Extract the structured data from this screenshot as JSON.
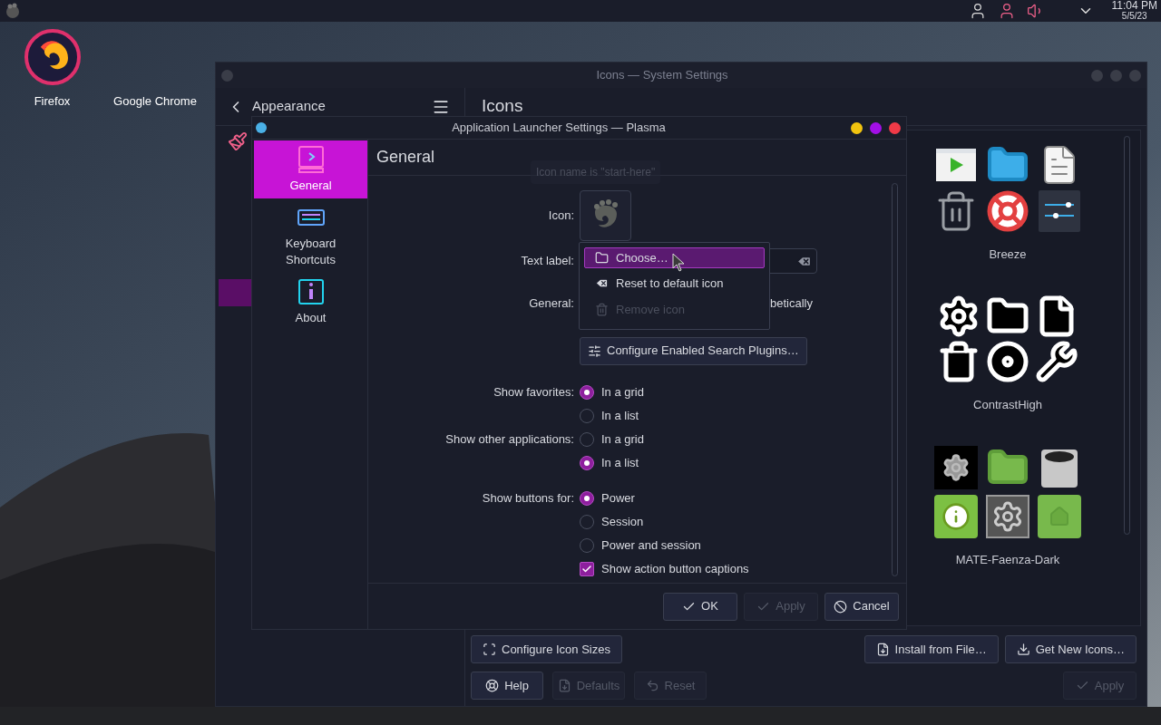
{
  "panel": {
    "time": "11:04 PM",
    "date": "5/5/23"
  },
  "desktop_icons": [
    {
      "label": "Firefox"
    },
    {
      "label": "Google Chrome"
    }
  ],
  "settings_window": {
    "title": "Icons — System Settings",
    "back_label": "Appearance",
    "page_title": "Icons",
    "themes": [
      {
        "name": "Breeze"
      },
      {
        "name": "ContrastHigh"
      },
      {
        "name": "MATE-Faenza-Dark"
      }
    ],
    "row_left": [
      {
        "label": "Configure Icon Sizes",
        "disabled": false
      }
    ],
    "row_right": [
      {
        "label": "Install from File…",
        "disabled": false
      },
      {
        "label": "Get New Icons…",
        "disabled": false
      }
    ],
    "footer_left": [
      {
        "label": "Help",
        "disabled": false
      },
      {
        "label": "Defaults",
        "disabled": true
      },
      {
        "label": "Reset",
        "disabled": true
      }
    ],
    "footer_right": [
      {
        "label": "Apply",
        "disabled": true
      }
    ]
  },
  "dialog": {
    "title": "Application Launcher Settings — Plasma",
    "pages": [
      {
        "label": "General",
        "selected": true
      },
      {
        "label": "Keyboard Shortcuts",
        "selected": false
      },
      {
        "label": "About",
        "selected": false
      }
    ],
    "heading": "General",
    "tooltip": "Icon name is \"start-here\"",
    "icon_label": "Icon:",
    "text_label": "Text label:",
    "general_label": "General:",
    "general_text": "betically",
    "plugins_button": "Configure Enabled Search Plugins…",
    "radio_groups": [
      {
        "label": "Show favorites:",
        "options": [
          {
            "label": "In a grid",
            "selected": true
          },
          {
            "label": "In a list",
            "selected": false
          }
        ]
      },
      {
        "label": "Show other applications:",
        "options": [
          {
            "label": "In a grid",
            "selected": false
          },
          {
            "label": "In a list",
            "selected": true
          }
        ]
      },
      {
        "label": "Show buttons for:",
        "options": [
          {
            "label": "Power",
            "selected": true
          },
          {
            "label": "Session",
            "selected": false
          },
          {
            "label": "Power and session",
            "selected": false
          }
        ]
      }
    ],
    "checkbox": {
      "label": "Show action button captions",
      "checked": true
    },
    "menu": [
      {
        "label": "Choose…",
        "selected": true,
        "disabled": false
      },
      {
        "label": "Reset to default icon",
        "selected": false,
        "disabled": false
      },
      {
        "label": "Remove icon",
        "selected": false,
        "disabled": true
      }
    ],
    "buttons": [
      {
        "label": "OK",
        "disabled": false
      },
      {
        "label": "Apply",
        "disabled": true
      },
      {
        "label": "Cancel",
        "disabled": false
      }
    ]
  }
}
